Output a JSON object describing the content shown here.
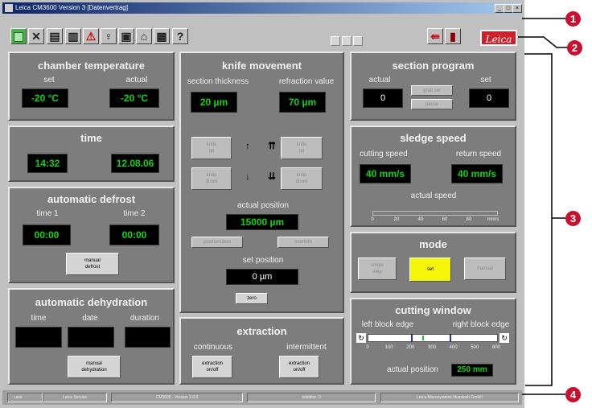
{
  "window": {
    "title": "Leica CM3600 Version 3 [Datenvertrag]",
    "controls": [
      "_",
      "□",
      "×"
    ]
  },
  "toolbar": {
    "help_label": "?",
    "nav_labels": [
      "1",
      "2",
      "3"
    ],
    "logo_text": "Leica"
  },
  "chamber_temperature": {
    "title": "chamber temperature",
    "set_label": "set",
    "actual_label": "actual",
    "set_value": "-20 °C",
    "actual_value": "-20 °C"
  },
  "time": {
    "title": "time",
    "clock": "14:32",
    "date": "12.08.06"
  },
  "automatic_defrost": {
    "title": "automatic defrost",
    "time1_label": "time 1",
    "time2_label": "time 2",
    "time1_value": "00:00",
    "time2_value": "00:00",
    "manual_button": "manual\ndefrost"
  },
  "automatic_dehydration": {
    "title": "automatic dehydration",
    "time_label": "time",
    "date_label": "date",
    "duration_label": "duration",
    "manual_button": "manual\ndehydration"
  },
  "knife_movement": {
    "title": "knife movement",
    "section_thickness_label": "section thickness",
    "refraction_label": "refraction value",
    "section_thickness_value": "20 µm",
    "refraction_value": "70 µm",
    "knife_up_left": "knife\nup",
    "knife_up_right": "knife\nup",
    "knife_down_left": "knife\ndown",
    "knife_down_right": "knife\ndown",
    "actual_position_label": "actual position",
    "actual_position_value": "15000 µm",
    "position_button": "position/zero",
    "overtrim_button": "overtrim",
    "set_position_label": "set position",
    "set_position_value": "0 µm",
    "zero_button": "zero"
  },
  "extraction": {
    "title": "extraction",
    "continuous_label": "continuous",
    "intermittent_label": "intermittent",
    "continuous_button": "extraction\non/off",
    "intermittent_button": "extraction\non/off"
  },
  "section_program": {
    "title": "section program",
    "actual_label": "actual",
    "set_label": "set",
    "actual_value": "0",
    "set_value": "0",
    "program_button": "grab set",
    "pause_button": "pause"
  },
  "sledge_speed": {
    "title": "sledge speed",
    "cutting_label": "cutting speed",
    "return_label": "return speed",
    "cutting_value": "40 mm/s",
    "return_value": "40 mm/s",
    "actual_speed_label": "actual speed",
    "actual_speed_fraction": 0.0,
    "scale_ticks": [
      "0",
      "20",
      "40",
      "60",
      "80",
      "mm/s"
    ]
  },
  "mode": {
    "title": "mode",
    "buttons": [
      "single\nstep",
      "set",
      "manual"
    ],
    "active_index": 1,
    "active_color": "#f5f50a"
  },
  "cutting_window": {
    "title": "cutting window",
    "left_label": "left block edge",
    "right_label": "right block edge",
    "scale_ticks": [
      "0",
      "100",
      "200",
      "300",
      "400",
      "500",
      "600"
    ],
    "scale_max": 600,
    "left_edge": 200,
    "right_edge": 380,
    "current": 250,
    "actual_position_label": "actual position",
    "actual_position_value": "250 mm"
  },
  "statusbar": {
    "fields": [
      "user",
      "Leica Service",
      "CM3600 - Version 3.0.0",
      "Inhibitor: 0",
      "Leica Microsystems Nussloch GmbH"
    ]
  },
  "callouts": [
    "1",
    "2",
    "3",
    "4"
  ],
  "colors": {
    "panel": "#7d7d7d",
    "led_green": "#13d313",
    "callout_red": "#c8102e",
    "brand_red": "#d0202a"
  }
}
